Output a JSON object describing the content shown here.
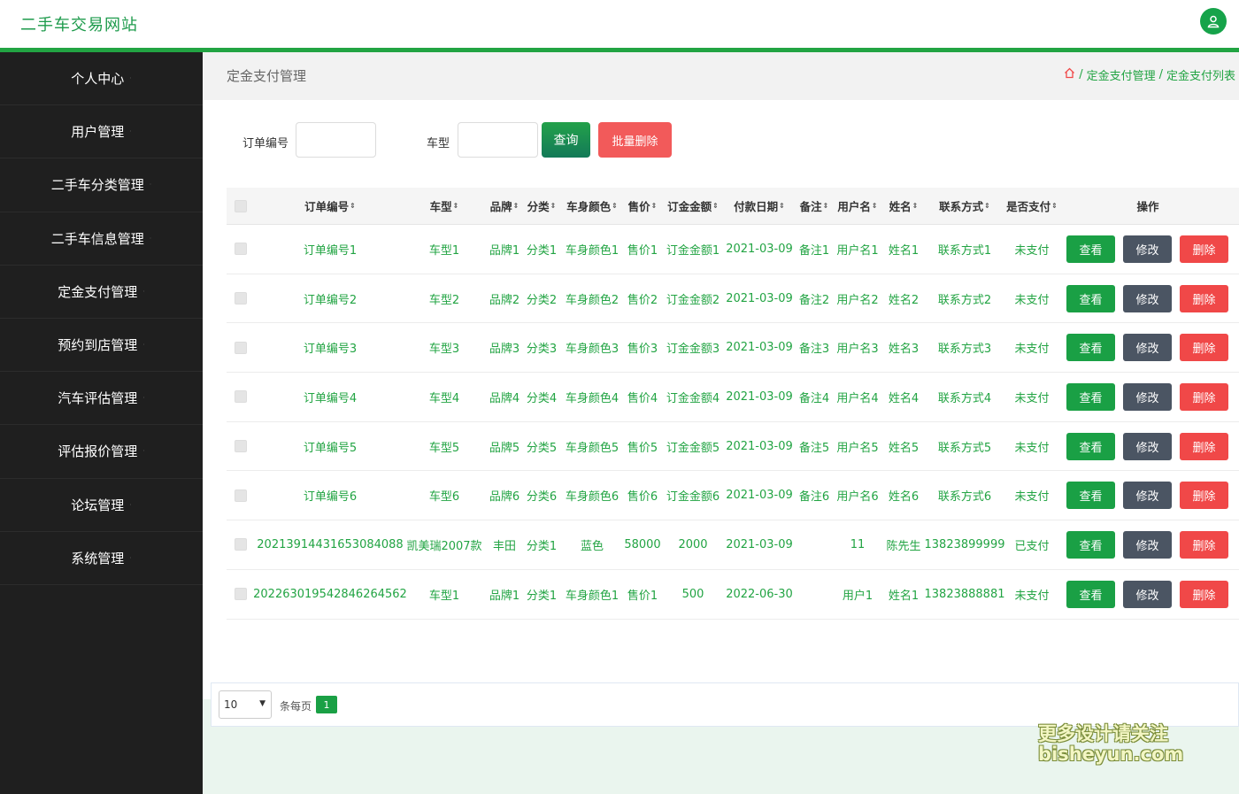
{
  "app": {
    "title": "二手车交易网站"
  },
  "colors": {
    "brand": "#22a443",
    "sidebar_bg": "#1f1f1f",
    "danger": "#f04848",
    "edit": "#4b5563"
  },
  "sidebar": {
    "items": [
      {
        "label": "个人中心"
      },
      {
        "label": "用户管理"
      },
      {
        "label": "二手车分类管理"
      },
      {
        "label": "二手车信息管理"
      },
      {
        "label": "定金支付管理"
      },
      {
        "label": "预约到店管理"
      },
      {
        "label": "汽车评估管理"
      },
      {
        "label": "评估报价管理"
      },
      {
        "label": "论坛管理"
      },
      {
        "label": "系统管理"
      }
    ]
  },
  "page": {
    "title": "定金支付管理",
    "breadcrumb": [
      "定金支付管理",
      "定金支付列表"
    ]
  },
  "search": {
    "order_label": "订单编号",
    "model_label": "车型",
    "query_button": "查询",
    "batch_delete_button": "批量删除"
  },
  "table": {
    "headers": [
      "订单编号",
      "车型",
      "品牌",
      "分类",
      "车身颜色",
      "售价",
      "订金金额",
      "付款日期",
      "备注",
      "用户名",
      "姓名",
      "联系方式",
      "是否支付",
      "操作"
    ],
    "rows": [
      [
        "订单编号1",
        "车型1",
        "品牌1",
        "分类1",
        "车身颜色1",
        "售价1",
        "订金金额1",
        "2021-03-09",
        "备注1",
        "用户名1",
        "姓名1",
        "联系方式1",
        "未支付"
      ],
      [
        "订单编号2",
        "车型2",
        "品牌2",
        "分类2",
        "车身颜色2",
        "售价2",
        "订金金额2",
        "2021-03-09",
        "备注2",
        "用户名2",
        "姓名2",
        "联系方式2",
        "未支付"
      ],
      [
        "订单编号3",
        "车型3",
        "品牌3",
        "分类3",
        "车身颜色3",
        "售价3",
        "订金金额3",
        "2021-03-09",
        "备注3",
        "用户名3",
        "姓名3",
        "联系方式3",
        "未支付"
      ],
      [
        "订单编号4",
        "车型4",
        "品牌4",
        "分类4",
        "车身颜色4",
        "售价4",
        "订金金额4",
        "2021-03-09",
        "备注4",
        "用户名4",
        "姓名4",
        "联系方式4",
        "未支付"
      ],
      [
        "订单编号5",
        "车型5",
        "品牌5",
        "分类5",
        "车身颜色5",
        "售价5",
        "订金金额5",
        "2021-03-09",
        "备注5",
        "用户名5",
        "姓名5",
        "联系方式5",
        "未支付"
      ],
      [
        "订单编号6",
        "车型6",
        "品牌6",
        "分类6",
        "车身颜色6",
        "售价6",
        "订金金额6",
        "2021-03-09",
        "备注6",
        "用户名6",
        "姓名6",
        "联系方式6",
        "未支付"
      ],
      [
        "20213914431653084088",
        "凯美瑞2007款",
        "丰田",
        "分类1",
        "蓝色",
        "58000",
        "2000",
        "2021-03-09",
        "",
        "11",
        "陈先生",
        "13823899999",
        "已支付"
      ],
      [
        "20226301954284626456​2",
        "车型1",
        "品牌1",
        "分类1",
        "车身颜色1",
        "售价1",
        "500",
        "2022-06-30",
        "",
        "用户1",
        "姓名1",
        "13823888881",
        "未支付"
      ]
    ],
    "actions": {
      "view": "查看",
      "edit": "修改",
      "delete": "删除"
    }
  },
  "pager": {
    "page_size": "10",
    "per_page_label": "条每页",
    "current_page": "1"
  },
  "watermark": {
    "line1": "更多设计请关注",
    "line2": "bisheyun.com"
  }
}
